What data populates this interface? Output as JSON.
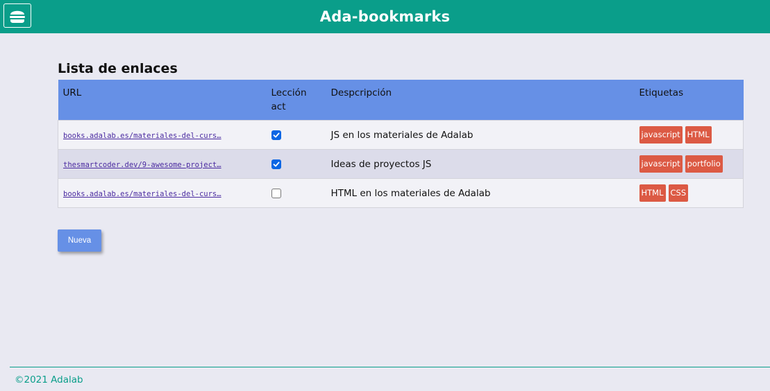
{
  "header": {
    "title": "Ada-bookmarks",
    "menu_icon": "hamburger-icon"
  },
  "main": {
    "title": "Lista de enlaces",
    "table": {
      "headers": {
        "url": "URL",
        "lesson_line1": "Lección",
        "lesson_line2": "act",
        "description": "Despcripción",
        "tags": "Etiquetas"
      },
      "rows": [
        {
          "url": "books.adalab.es/materiales-del-curs…",
          "checked": true,
          "description": "JS en los materiales de Adalab",
          "tags": [
            "javascript",
            "HTML"
          ]
        },
        {
          "url": "thesmartcoder.dev/9-awesome-project…",
          "checked": true,
          "description": "Ideas de proyectos JS",
          "tags": [
            "javascript",
            "portfolio"
          ]
        },
        {
          "url": "books.adalab.es/materiales-del-curs…",
          "checked": false,
          "description": "HTML en los materiales de Adalab",
          "tags": [
            "HTML",
            "CSS"
          ]
        }
      ]
    },
    "new_button": "Nueva"
  },
  "footer": {
    "text": "©2021 Adalab"
  },
  "colors": {
    "header": "#0a9e8a",
    "table_header": "#6690e6",
    "tag": "#dc5a44",
    "checkbox": "#0b66e4"
  }
}
